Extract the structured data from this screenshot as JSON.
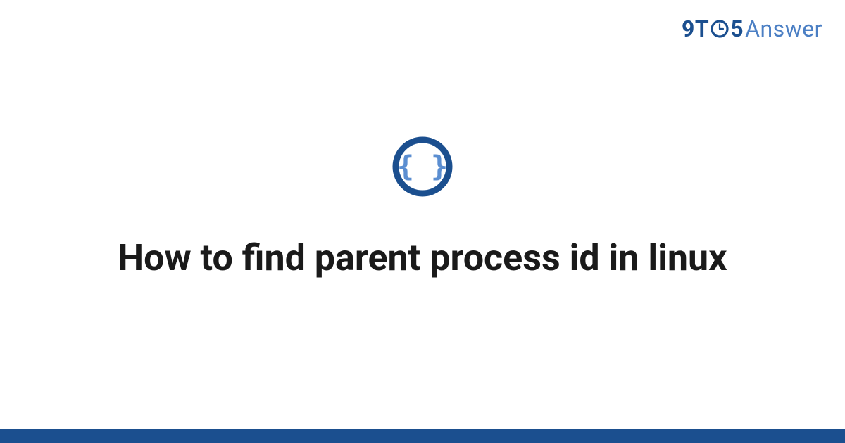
{
  "brand": {
    "part1": "9T",
    "part2": "5",
    "part3": "Answer"
  },
  "badge": {
    "icon_name": "curly-braces-icon"
  },
  "title": "How to find parent process id in linux",
  "colors": {
    "brand_dark": "#1b4f8f",
    "brand_light": "#4b7fc4",
    "badge_ring": "#1b4f8f",
    "badge_inner": "#5b8ed1",
    "footer": "#1b4f8f"
  }
}
